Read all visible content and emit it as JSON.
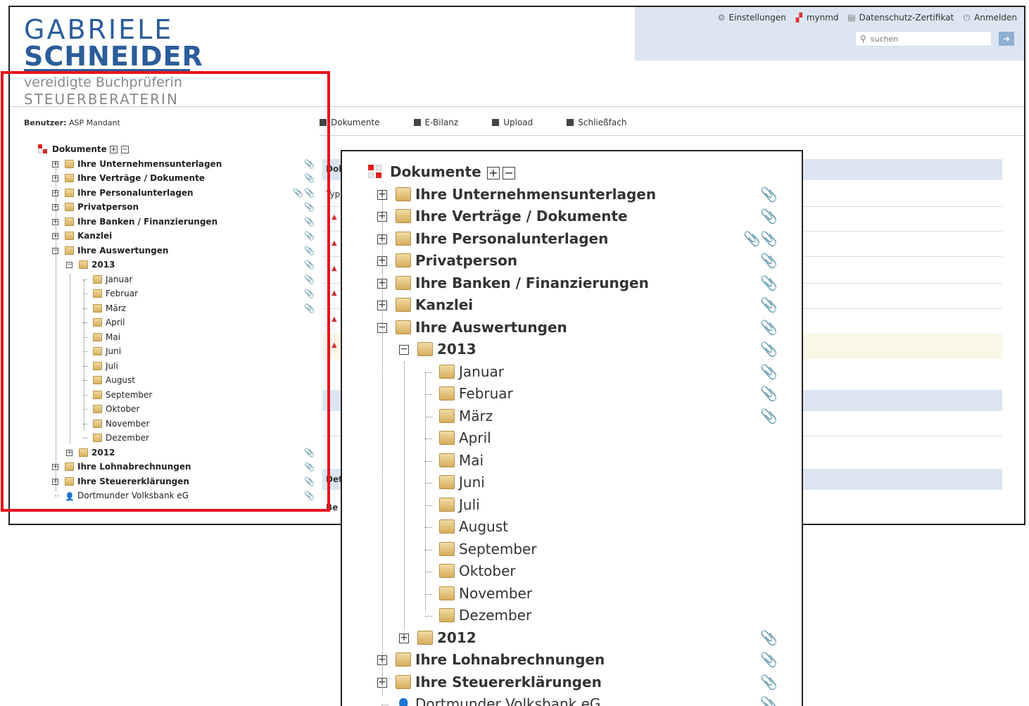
{
  "header": {
    "links": [
      {
        "icon": "gear-icon",
        "label": "Einstellungen"
      },
      {
        "icon": "mynmd-icon",
        "label": "mynmd"
      },
      {
        "icon": "certificate-icon",
        "label": "Datenschutz-Zertifikat"
      },
      {
        "icon": "power-icon",
        "label": "Anmelden"
      }
    ],
    "search_placeholder": "suchen"
  },
  "logo": {
    "line1": "GABRIELE",
    "line2": "SCHNEIDER",
    "line3": "vereidigte  Buchprüferin",
    "line4": "STEUERBERATERIN"
  },
  "user": {
    "label": "Benutzer:",
    "value": "ASP Mandant"
  },
  "nav_tabs": [
    "Dokumente",
    "E-Bilanz",
    "Upload",
    "Schließfach"
  ],
  "background_fragments": [
    "Dok",
    "Typ",
    "Det",
    "Be"
  ],
  "tree": {
    "root_label": "Dokumente",
    "expand_all": "+",
    "collapse_all": "−",
    "items": [
      {
        "label": "Ihre Unternehmensunterlagen",
        "level": 1,
        "bold": true,
        "toggle": "+",
        "clips": [
          "green"
        ]
      },
      {
        "label": "Ihre Verträge / Dokumente",
        "level": 1,
        "bold": true,
        "toggle": "+",
        "clips": [
          "green"
        ]
      },
      {
        "label": "Ihre Personalunterlagen",
        "level": 1,
        "bold": true,
        "toggle": "+",
        "clips": [
          "green",
          "gray"
        ]
      },
      {
        "label": "Privatperson",
        "level": 1,
        "bold": true,
        "toggle": "+",
        "clips": [
          "green"
        ]
      },
      {
        "label": "Ihre Banken / Finanzierungen",
        "level": 1,
        "bold": true,
        "toggle": "+",
        "clips": [
          "green"
        ]
      },
      {
        "label": "Kanzlei",
        "level": 1,
        "bold": true,
        "toggle": "+",
        "clips": [
          "green"
        ]
      },
      {
        "label": "Ihre Auswertungen",
        "level": 1,
        "bold": true,
        "toggle": "−",
        "clips": [
          "green"
        ]
      },
      {
        "label": "2013",
        "level": 2,
        "bold": true,
        "toggle": "−",
        "clips": [
          "green"
        ]
      },
      {
        "label": "Januar",
        "level": 3,
        "bold": false,
        "toggle": "",
        "clips": [
          "gray"
        ]
      },
      {
        "label": "Februar",
        "level": 3,
        "bold": false,
        "toggle": "",
        "clips": [
          "gray"
        ]
      },
      {
        "label": "März",
        "level": 3,
        "bold": false,
        "toggle": "",
        "clips": [
          "gray"
        ]
      },
      {
        "label": "April",
        "level": 3,
        "bold": false,
        "toggle": "",
        "clips": []
      },
      {
        "label": "Mai",
        "level": 3,
        "bold": false,
        "toggle": "",
        "clips": []
      },
      {
        "label": "Juni",
        "level": 3,
        "bold": false,
        "toggle": "",
        "clips": []
      },
      {
        "label": "Juli",
        "level": 3,
        "bold": false,
        "toggle": "",
        "clips": []
      },
      {
        "label": "August",
        "level": 3,
        "bold": false,
        "toggle": "",
        "clips": []
      },
      {
        "label": "September",
        "level": 3,
        "bold": false,
        "toggle": "",
        "clips": []
      },
      {
        "label": "Oktober",
        "level": 3,
        "bold": false,
        "toggle": "",
        "clips": []
      },
      {
        "label": "November",
        "level": 3,
        "bold": false,
        "toggle": "",
        "clips": []
      },
      {
        "label": "Dezember",
        "level": 3,
        "bold": false,
        "toggle": "",
        "clips": []
      },
      {
        "label": "2012",
        "level": 2,
        "bold": true,
        "toggle": "+",
        "clips": [
          "green"
        ]
      },
      {
        "label": "Ihre Lohnabrechnungen",
        "level": 1,
        "bold": true,
        "toggle": "+",
        "clips": [
          "green"
        ]
      },
      {
        "label": "Ihre Steuererklärungen",
        "level": 1,
        "bold": true,
        "toggle": "+",
        "clips": [
          "green"
        ]
      },
      {
        "label": "Dortmunder Volksbank eG",
        "level": 1,
        "bold": false,
        "toggle": "",
        "icon": "bank-user-icon",
        "clips": [
          "gray"
        ]
      }
    ]
  },
  "colors": {
    "accent_blue": "#2b5d9b",
    "topbar_bg": "#dce6f2",
    "highlight_red": "#e8141b",
    "clip_green": "#4a9a3a",
    "clip_gray": "#888888"
  }
}
